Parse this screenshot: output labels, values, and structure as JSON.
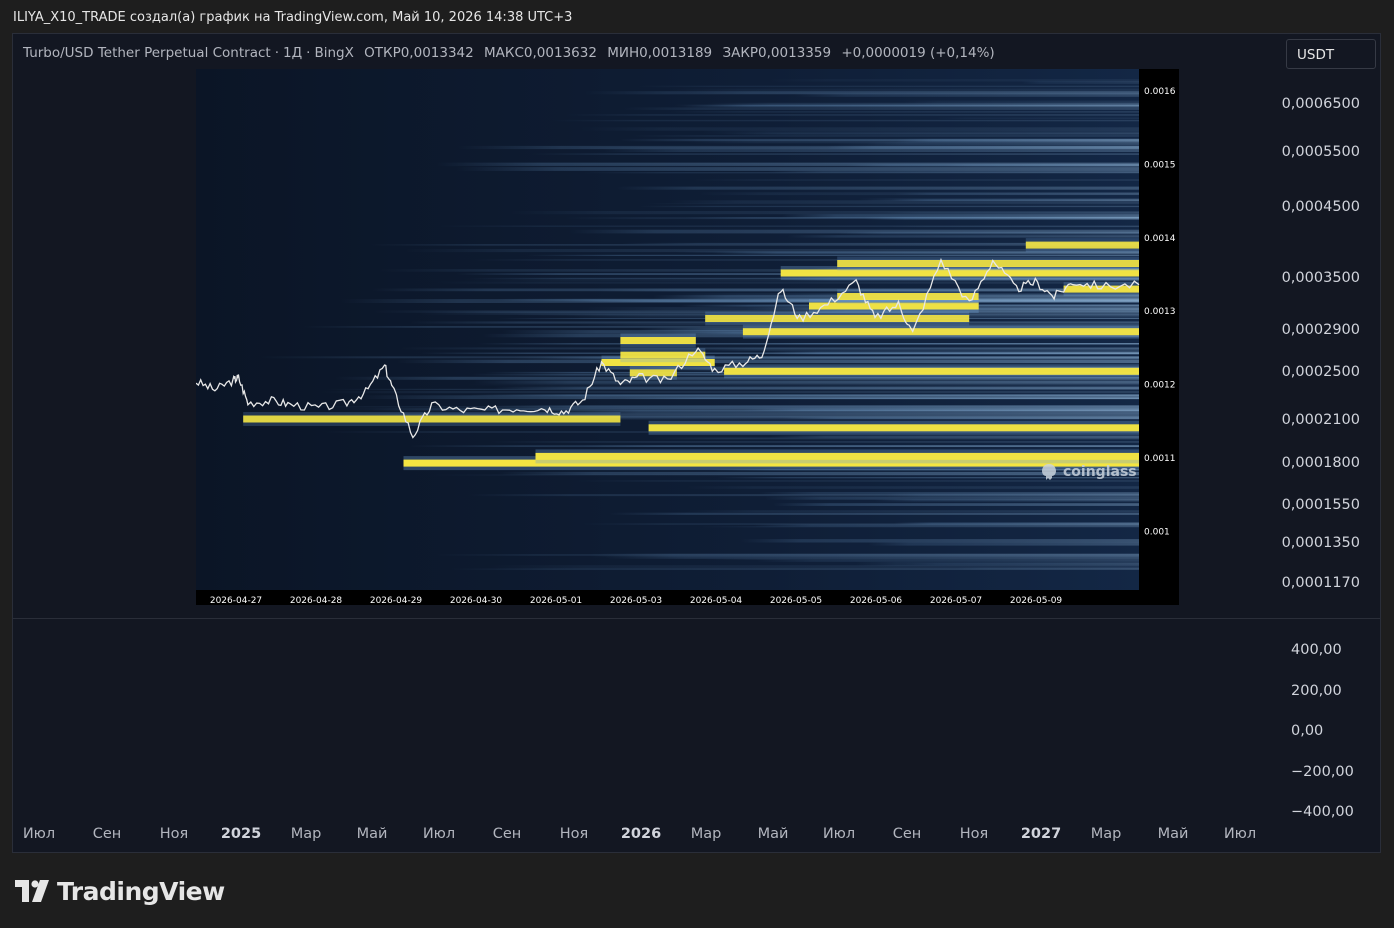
{
  "page_header": "ILIYA_X10_TRADE создал(а) график на TradingView.com, Май 10, 2026 14:38 UTC+3",
  "legend": {
    "symbol": "Turbo/USD Tether Perpetual Contract",
    "interval": "1Д",
    "exchange": "BingX",
    "open": "ОТКР0,0013342",
    "high": "МАКС0,0013632",
    "low": "МИН0,0013189",
    "close": "ЗАКР0,0013359",
    "change": "+0,0000019 (+0,14%)"
  },
  "currency_button": "USDT",
  "price_axis": [
    "0,0006500",
    "0,0005500",
    "0,0004500",
    "0,0003500",
    "0,0002900",
    "0,0002500",
    "0,0002100",
    "0,0001800",
    "0,0001550",
    "0,0001350",
    "0,0001170"
  ],
  "oscillator_axis": [
    "400,00",
    "200,00",
    "0,00",
    "−200,00",
    "−400,00"
  ],
  "time_axis": [
    {
      "label": "Июл",
      "strong": false
    },
    {
      "label": "Сен",
      "strong": false
    },
    {
      "label": "Ноя",
      "strong": false
    },
    {
      "label": "2025",
      "strong": true
    },
    {
      "label": "Мар",
      "strong": false
    },
    {
      "label": "Май",
      "strong": false
    },
    {
      "label": "Июл",
      "strong": false
    },
    {
      "label": "Сен",
      "strong": false
    },
    {
      "label": "Ноя",
      "strong": false
    },
    {
      "label": "2026",
      "strong": true
    },
    {
      "label": "Мар",
      "strong": false
    },
    {
      "label": "Май",
      "strong": false
    },
    {
      "label": "Июл",
      "strong": false
    },
    {
      "label": "Сен",
      "strong": false
    },
    {
      "label": "Ноя",
      "strong": false
    },
    {
      "label": "2027",
      "strong": true
    },
    {
      "label": "Мар",
      "strong": false
    },
    {
      "label": "Май",
      "strong": false
    },
    {
      "label": "Июл",
      "strong": false
    }
  ],
  "brand": "TradingView",
  "chart_data": {
    "type": "heatmap",
    "title": "",
    "watermark": "coinglass",
    "y_ticks": [
      "0.0016",
      "0.0015",
      "0.0014",
      "0.0013",
      "0.0012",
      "0.0011",
      "0.001"
    ],
    "x_ticks": [
      "2026-04-27",
      "2026-04-28",
      "2026-04-29",
      "2026-04-30",
      "2026-05-01",
      "2026-05-03",
      "2026-05-04",
      "2026-05-05",
      "2026-05-06",
      "2026-05-07",
      "2026-05-09"
    ],
    "ylim": [
      0.00092,
      0.00163
    ],
    "colors": {
      "background": "#0d1a2e",
      "low": "#1b3556",
      "mid": "#6f9fcf",
      "high": "#f4e542",
      "price_line": "#e8e8e8"
    },
    "price_path": [
      {
        "x": 0.0,
        "y": 0.001204
      },
      {
        "x": 0.02,
        "y": 0.001193
      },
      {
        "x": 0.04,
        "y": 0.001206
      },
      {
        "x": 0.045,
        "y": 0.00121
      },
      {
        "x": 0.055,
        "y": 0.001175
      },
      {
        "x": 0.08,
        "y": 0.001178
      },
      {
        "x": 0.1,
        "y": 0.001173
      },
      {
        "x": 0.13,
        "y": 0.001168
      },
      {
        "x": 0.16,
        "y": 0.001175
      },
      {
        "x": 0.18,
        "y": 0.00119
      },
      {
        "x": 0.2,
        "y": 0.001225
      },
      {
        "x": 0.21,
        "y": 0.00119
      },
      {
        "x": 0.23,
        "y": 0.00113
      },
      {
        "x": 0.25,
        "y": 0.001172
      },
      {
        "x": 0.28,
        "y": 0.001165
      },
      {
        "x": 0.31,
        "y": 0.001165
      },
      {
        "x": 0.34,
        "y": 0.001168
      },
      {
        "x": 0.37,
        "y": 0.001168
      },
      {
        "x": 0.39,
        "y": 0.001163
      },
      {
        "x": 0.41,
        "y": 0.001178
      },
      {
        "x": 0.43,
        "y": 0.00123
      },
      {
        "x": 0.45,
        "y": 0.0012
      },
      {
        "x": 0.47,
        "y": 0.00121
      },
      {
        "x": 0.5,
        "y": 0.001205
      },
      {
        "x": 0.53,
        "y": 0.00125
      },
      {
        "x": 0.55,
        "y": 0.00122
      },
      {
        "x": 0.58,
        "y": 0.00123
      },
      {
        "x": 0.6,
        "y": 0.00124
      },
      {
        "x": 0.62,
        "y": 0.00133
      },
      {
        "x": 0.64,
        "y": 0.00129
      },
      {
        "x": 0.67,
        "y": 0.00131
      },
      {
        "x": 0.7,
        "y": 0.00134
      },
      {
        "x": 0.72,
        "y": 0.00129
      },
      {
        "x": 0.745,
        "y": 0.00131
      },
      {
        "x": 0.76,
        "y": 0.00127
      },
      {
        "x": 0.79,
        "y": 0.00137
      },
      {
        "x": 0.82,
        "y": 0.00131
      },
      {
        "x": 0.845,
        "y": 0.00137
      },
      {
        "x": 0.87,
        "y": 0.00133
      },
      {
        "x": 0.89,
        "y": 0.00134
      },
      {
        "x": 0.91,
        "y": 0.00132
      },
      {
        "x": 0.93,
        "y": 0.00134
      },
      {
        "x": 0.96,
        "y": 0.001334
      },
      {
        "x": 1.0,
        "y": 0.001336
      }
    ],
    "bands": [
      {
        "y": 0.001093,
        "x0": 0.22,
        "x1": 1.0,
        "intensity": 1.0
      },
      {
        "y": 0.001102,
        "x0": 0.36,
        "x1": 1.0,
        "intensity": 0.95
      },
      {
        "y": 0.001141,
        "x0": 0.48,
        "x1": 1.0,
        "intensity": 0.9
      },
      {
        "y": 0.001153,
        "x0": 0.05,
        "x1": 0.45,
        "intensity": 0.7
      },
      {
        "y": 0.001216,
        "x0": 0.46,
        "x1": 0.51,
        "intensity": 0.75
      },
      {
        "y": 0.001218,
        "x0": 0.56,
        "x1": 1.0,
        "intensity": 0.9
      },
      {
        "y": 0.00123,
        "x0": 0.43,
        "x1": 0.55,
        "intensity": 0.95
      },
      {
        "y": 0.00124,
        "x0": 0.45,
        "x1": 0.54,
        "intensity": 0.8
      },
      {
        "y": 0.00126,
        "x0": 0.45,
        "x1": 0.53,
        "intensity": 0.85
      },
      {
        "y": 0.001272,
        "x0": 0.58,
        "x1": 1.0,
        "intensity": 0.85
      },
      {
        "y": 0.00129,
        "x0": 0.54,
        "x1": 0.82,
        "intensity": 0.75
      },
      {
        "y": 0.001307,
        "x0": 0.65,
        "x1": 0.83,
        "intensity": 0.9
      },
      {
        "y": 0.00132,
        "x0": 0.68,
        "x1": 0.83,
        "intensity": 0.8
      },
      {
        "y": 0.00133,
        "x0": 0.92,
        "x1": 1.0,
        "intensity": 0.85
      },
      {
        "y": 0.001352,
        "x0": 0.62,
        "x1": 1.0,
        "intensity": 0.95
      },
      {
        "y": 0.001365,
        "x0": 0.68,
        "x1": 1.0,
        "intensity": 0.75
      },
      {
        "y": 0.00139,
        "x0": 0.88,
        "x1": 1.0,
        "intensity": 0.7
      }
    ]
  }
}
